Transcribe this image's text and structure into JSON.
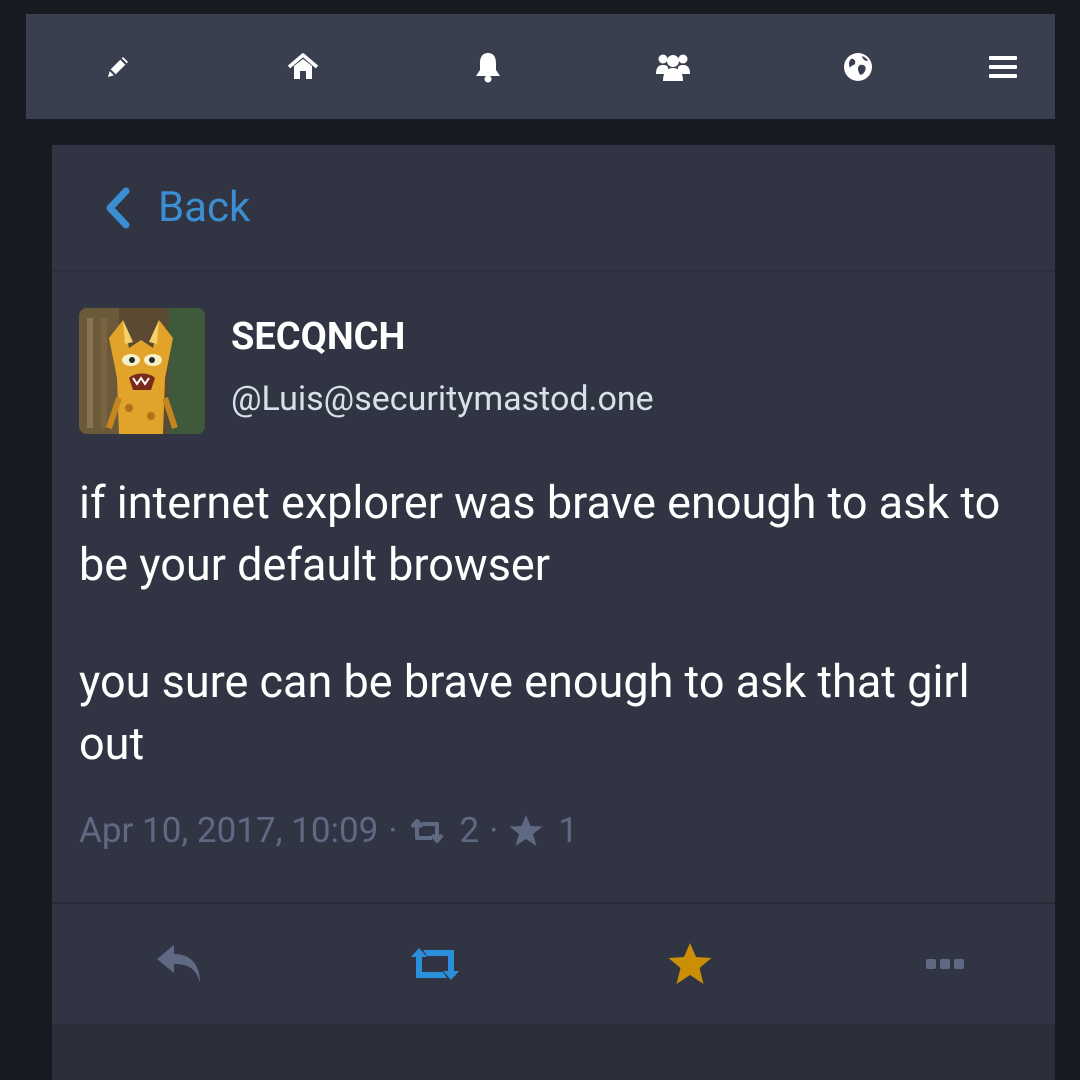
{
  "topbar": {
    "items": [
      {
        "icon": "pencil-icon",
        "label": "Compose"
      },
      {
        "icon": "home-icon",
        "label": "Home"
      },
      {
        "icon": "bell-icon",
        "label": "Notifications"
      },
      {
        "icon": "users-icon",
        "label": "Local"
      },
      {
        "icon": "globe-icon",
        "label": "Federated"
      },
      {
        "icon": "menu-icon",
        "label": "Menu"
      }
    ]
  },
  "back": {
    "label": "Back",
    "icon": "chevron-left-icon"
  },
  "status": {
    "display_name": "SECQNCH",
    "acct": "@Luis@securitymastod.one",
    "content": [
      "if internet explorer was brave enough to ask to be your default browser",
      "you sure can be brave enough to ask that girl out"
    ],
    "timestamp": "Apr 10, 2017, 10:09",
    "separator": "·",
    "reblogs_count": "2",
    "favourites_count": "1"
  },
  "actions": [
    {
      "icon": "reply-icon",
      "color": "#606984"
    },
    {
      "icon": "boost-icon",
      "color": "#2b90d9"
    },
    {
      "icon": "star-icon",
      "color": "#ca8f04"
    },
    {
      "icon": "ellipsis-icon",
      "color": "#606984"
    }
  ],
  "colors": {
    "background": "#191b22",
    "topbar": "#393f4f",
    "panel": "#313543",
    "accent": "#2b90d9",
    "favourite": "#ca8f04",
    "muted": "#606984"
  }
}
